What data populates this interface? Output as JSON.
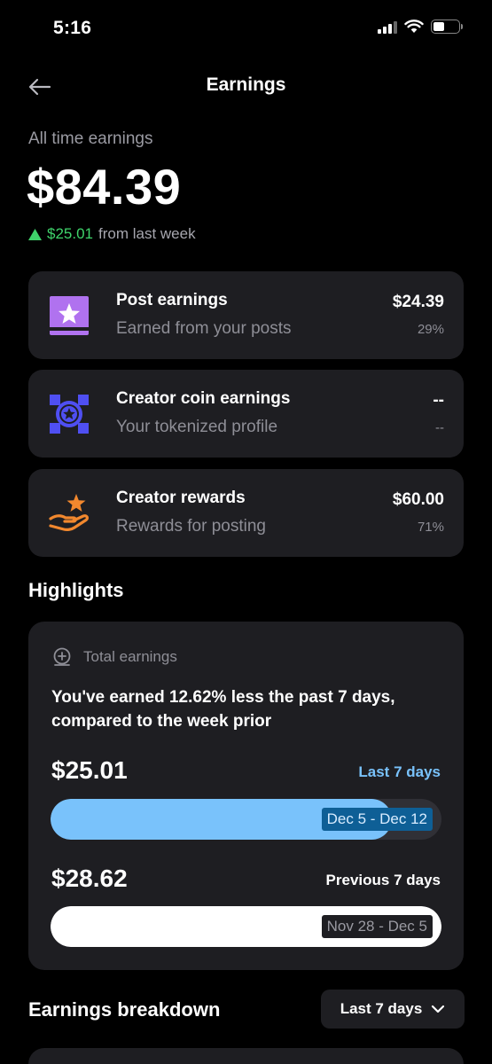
{
  "status_bar": {
    "time": "5:16"
  },
  "header": {
    "title": "Earnings"
  },
  "summary": {
    "label": "All time earnings",
    "amount": "$84.39",
    "change_amount": "$25.01",
    "change_text": "from last week"
  },
  "sources": [
    {
      "title": "Post earnings",
      "subtitle": "Earned from your posts",
      "value": "$24.39",
      "percent": "29%",
      "icon": "post-star-icon",
      "color": "#b072ef"
    },
    {
      "title": "Creator coin earnings",
      "subtitle": "Your tokenized profile",
      "value": "--",
      "percent": "--",
      "icon": "creator-coin-icon",
      "color": "#4f4ff2"
    },
    {
      "title": "Creator rewards",
      "subtitle": "Rewards for posting",
      "value": "$60.00",
      "percent": "71%",
      "icon": "hand-star-icon",
      "color": "#f2882e"
    }
  ],
  "highlights": {
    "title": "Highlights",
    "card_label": "Total earnings",
    "description": "You've earned 12.62% less the past 7 days, compared to the week prior",
    "current": {
      "amount": "$25.01",
      "range_label": "Last 7 days",
      "dates": "Dec 5 - Dec 12",
      "fill_fraction": 0.874,
      "color": "#79c2fb"
    },
    "previous": {
      "amount": "$28.62",
      "range_label": "Previous 7 days",
      "dates": "Nov 28 - Dec 5",
      "fill_fraction": 1.0,
      "color": "#ffffff"
    }
  },
  "breakdown": {
    "title": "Earnings breakdown",
    "period_selected": "Last 7 days"
  }
}
